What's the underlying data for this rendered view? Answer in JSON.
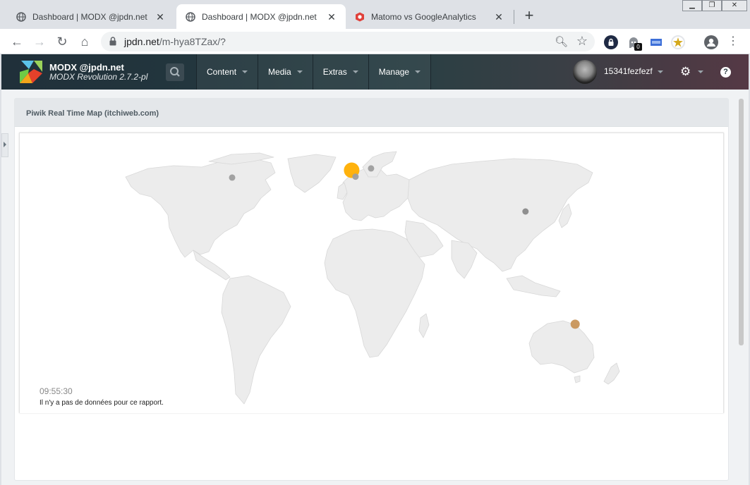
{
  "browser": {
    "tabs": [
      {
        "title": "Dashboard | MODX @jpdn.net",
        "active": false,
        "icon": "globe-icon"
      },
      {
        "title": "Dashboard | MODX @jpdn.net",
        "active": true,
        "icon": "globe-icon"
      },
      {
        "title": "Matomo vs GoogleAnalytics",
        "active": false,
        "icon": "matomo-icon"
      }
    ],
    "new_tab_label": "+",
    "url_host": "jpdn.net",
    "url_path": "/m-hya8TZax/?",
    "extension_badge": "0"
  },
  "modx": {
    "site_name": "MODX @jpdn.net",
    "version": "MODX Revolution 2.7.2-pl",
    "menu": [
      "Content",
      "Media",
      "Extras",
      "Manage"
    ],
    "user_name": "15341fezfezf",
    "help_label": "?"
  },
  "widget": {
    "title": "Piwik Real Time Map (itchiweb.com)",
    "time": "09:55:30",
    "no_data": "Il n'y a pas de données pour ce rapport."
  },
  "map": {
    "visits": [
      {
        "region": "France",
        "lat": 47.5,
        "lon": 2.0,
        "color": "#ffae00",
        "size": "large"
      },
      {
        "region": "Southern France",
        "lat": 44.0,
        "lon": 4.5,
        "color": "#9e9e9e",
        "size": "small"
      },
      {
        "region": "Central Europe",
        "lat": 48.5,
        "lon": 14.5,
        "color": "#9e9e9e",
        "size": "small"
      },
      {
        "region": "North America (East)",
        "lat": 43.5,
        "lon": -75.0,
        "color": "#9e9e9e",
        "size": "small"
      },
      {
        "region": "East Asia",
        "lat": 25.0,
        "lon": 114.0,
        "color": "#8a8a8a",
        "size": "small"
      },
      {
        "region": "Australia (South-East)",
        "lat": -36.5,
        "lon": 146.0,
        "color": "#c8955a",
        "size": "medium"
      }
    ]
  },
  "colors": {
    "header_bg": "#20303a",
    "land": "#ececec",
    "land_border": "#d8d8d8"
  }
}
